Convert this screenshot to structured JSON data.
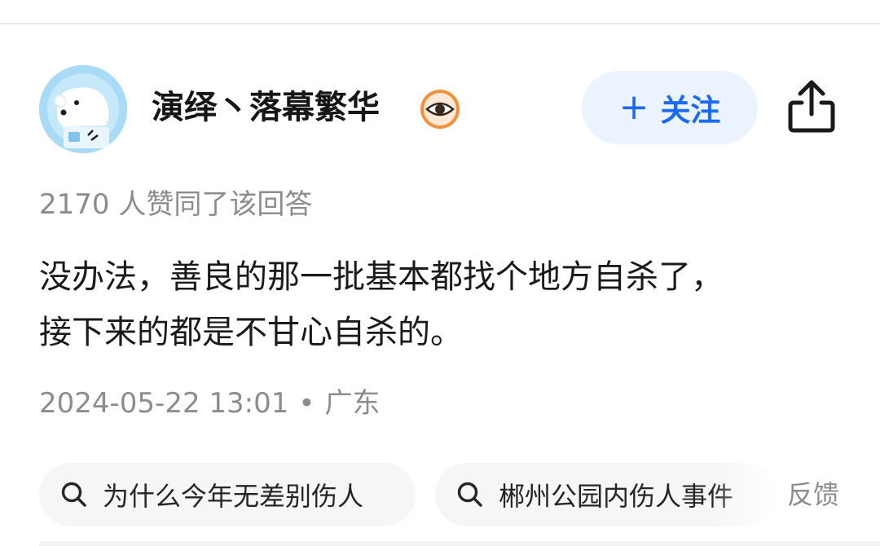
{
  "author": {
    "name": "演绎丶落幕繁华",
    "avatar_icon": "polar-bear-avatar",
    "badge_icon": "eye-icon",
    "badge_color": "#f0913b"
  },
  "actions": {
    "follow_plus": "+",
    "follow_label": "关注",
    "share_icon": "share-icon"
  },
  "answer": {
    "upvotes": "2170 人赞同了该回答",
    "lines": [
      "没办法，善良的那一批基本都找个地方自杀了，",
      "接下来的都是不甘心自杀的。"
    ],
    "date": "2024-05-22 13:01",
    "separator": "•",
    "location": "广东"
  },
  "related_searches": [
    {
      "label": "为什么今年无差别伤人",
      "icon": "search-icon"
    },
    {
      "label": "郴州公园内伤人事件",
      "icon": "search-icon"
    }
  ],
  "feedback_label": "反馈",
  "colors": {
    "accent": "#1a6bef",
    "follow_bg": "#ebf3fe",
    "muted_text": "#8c8c8c",
    "chip_bg": "#f5f6f7"
  }
}
